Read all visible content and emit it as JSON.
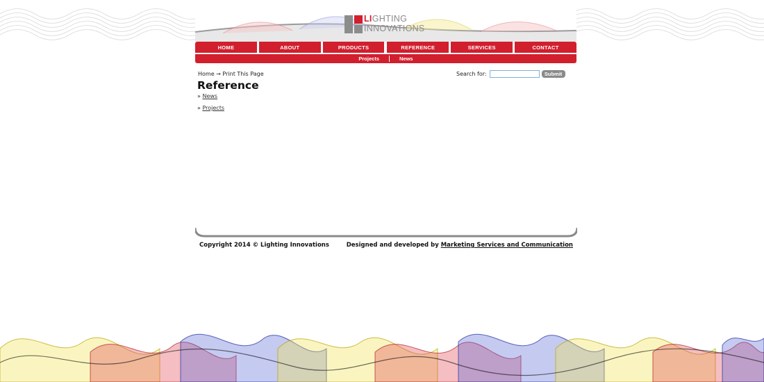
{
  "logo": {
    "line1_first": "LI",
    "line1_rest": "GHTING",
    "line2": "INNOVATIONS"
  },
  "nav": {
    "items": [
      "HOME",
      "ABOUT",
      "PRODUCTS",
      "REFERENCE",
      "SERVICES",
      "CONTACT"
    ],
    "active": "REFERENCE"
  },
  "subnav": {
    "items": [
      "Projects",
      "News"
    ]
  },
  "breadcrumb": {
    "home": "Home",
    "arrow": "→",
    "print": "Print This Page"
  },
  "search": {
    "label": "Search for:",
    "value": "",
    "submit": "Submit"
  },
  "page": {
    "title": "Reference",
    "bullet": "»",
    "links": [
      "News",
      "Projects"
    ]
  },
  "footer": {
    "copyright": "Copyright 2014 © Lighting Innovations",
    "credit_prefix": "Designed and developed by",
    "credit_link": "Marketing Services and Communication"
  },
  "colors": {
    "brand_red": "#d11f2e",
    "logo_gray": "#8c8c8c",
    "submit_gray": "#8a8a8a"
  }
}
